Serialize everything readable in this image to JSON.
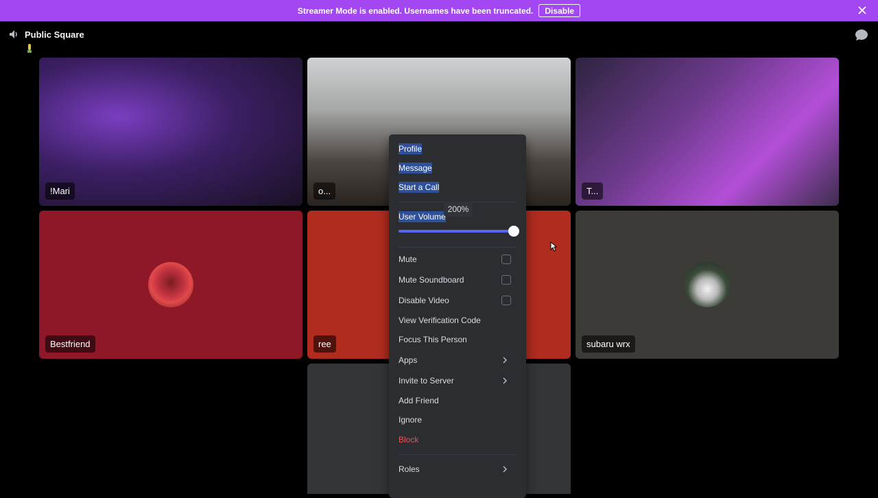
{
  "banner": {
    "message": "Streamer Mode is enabled. Usernames have been truncated.",
    "disable_label": "Disable",
    "color": "#a347f2"
  },
  "channel": {
    "title": "Public Square"
  },
  "tiles": [
    {
      "label": "!Mari",
      "bg": "#3b1f63"
    },
    {
      "label": "o...",
      "bg": "#a6a8a6"
    },
    {
      "label": "T...",
      "bg": "#6d3a8c"
    },
    {
      "label": "Bestfriend",
      "bg": "#8f1828"
    },
    {
      "label": "ree",
      "bg": "#b02c1f"
    },
    {
      "label": "subaru wrx",
      "bg": "#3c3b38"
    },
    {
      "label": "",
      "bg": "#343538"
    }
  ],
  "menu": {
    "profile": "Profile",
    "message": "Message",
    "start_call": "Start a Call",
    "user_volume": "User Volume",
    "volume_value": "200%",
    "volume_fraction": 1.0,
    "mute": "Mute",
    "mute_soundboard": "Mute Soundboard",
    "disable_video": "Disable Video",
    "view_verification": "View Verification Code",
    "focus": "Focus This Person",
    "apps": "Apps",
    "invite": "Invite to Server",
    "add_friend": "Add Friend",
    "ignore": "Ignore",
    "block": "Block",
    "roles": "Roles"
  },
  "colors": {
    "accent": "#5865f2",
    "danger": "#e5575c",
    "menu_bg": "#2b2d31"
  }
}
